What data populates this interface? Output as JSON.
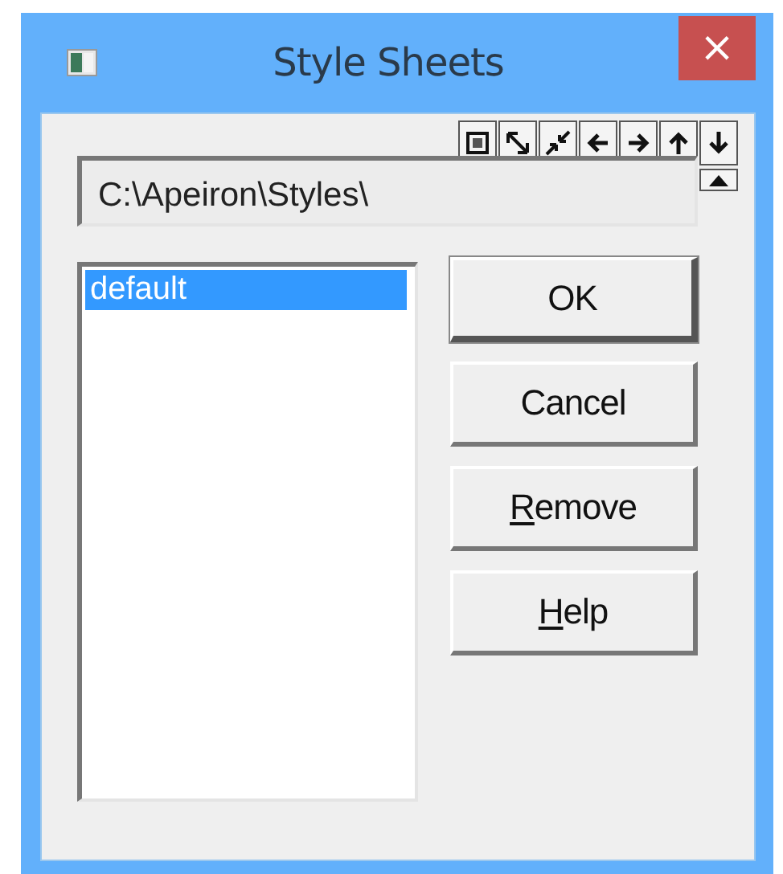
{
  "window": {
    "title": "Style Sheets",
    "close": "×"
  },
  "path_field": {
    "value": "C:\\Apeiron\\Styles\\"
  },
  "list": [
    {
      "label": "default",
      "selected": true
    }
  ],
  "buttons": [
    {
      "label": "OK",
      "default": true,
      "mnemonic_underlined": false
    },
    {
      "label": "Cancel",
      "default": false,
      "mnemonic_underlined": false
    },
    {
      "label": "Remove",
      "default": false,
      "mnemonic_underlined": true
    },
    {
      "label": "Help",
      "default": false,
      "mnemonic_underlined": true
    }
  ]
}
